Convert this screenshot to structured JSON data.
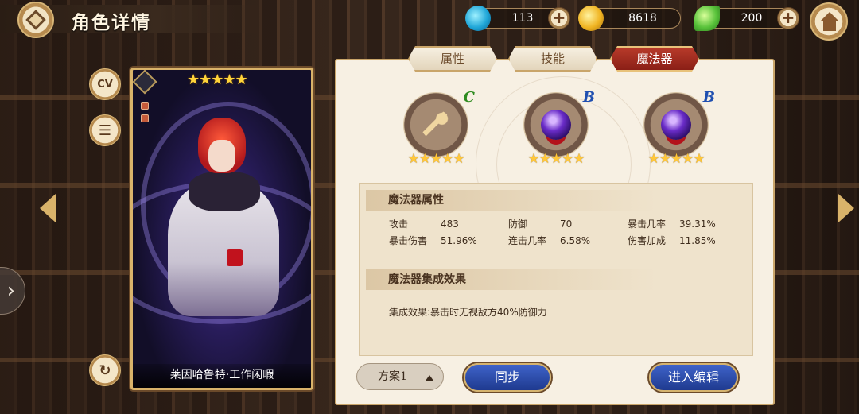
{
  "header": {
    "title": "角色详情",
    "resources": [
      {
        "icon": "gem-icon",
        "value": "113"
      },
      {
        "icon": "coin-icon",
        "value": "8618"
      },
      {
        "icon": "leaf-icon",
        "value": "200"
      }
    ],
    "plus_label": "+"
  },
  "side": {
    "cv_label": "CV"
  },
  "card": {
    "name": "莱因哈鲁特·工作闲暇",
    "stars": "★★★★★"
  },
  "tabs": [
    {
      "label": "属性",
      "active": false
    },
    {
      "label": "技能",
      "active": false
    },
    {
      "label": "魔法器",
      "active": true
    }
  ],
  "devices": [
    {
      "icon": "key-icon",
      "grade": "C",
      "grade_color": "#2e8b1f",
      "stars": "★★★★★"
    },
    {
      "icon": "orb-icon",
      "grade": "B",
      "grade_color": "#1f4fb0",
      "stars": "★★★★★"
    },
    {
      "icon": "orb-icon",
      "grade": "B",
      "grade_color": "#1f4fb0",
      "stars": "★★★★★"
    }
  ],
  "attributes": {
    "title": "魔法器属性",
    "items": [
      {
        "label": "攻击",
        "value": "483"
      },
      {
        "label": "防御",
        "value": "70"
      },
      {
        "label": "暴击几率",
        "value": "39.31%"
      },
      {
        "label": "暴击伤害",
        "value": "51.96%"
      },
      {
        "label": "连击几率",
        "value": "6.58%"
      },
      {
        "label": "伤害加成",
        "value": "11.85%"
      }
    ]
  },
  "effect": {
    "title": "魔法器集成效果",
    "text": "集成效果:暴击时无视敌方40%防御力"
  },
  "footer": {
    "preset": "方案1",
    "sync_label": "同步",
    "edit_label": "进入编辑"
  },
  "colors": {
    "accent_gold": "#c9a56a",
    "active_tab": "#8a1f16",
    "button_blue": "#1f3a8f"
  }
}
